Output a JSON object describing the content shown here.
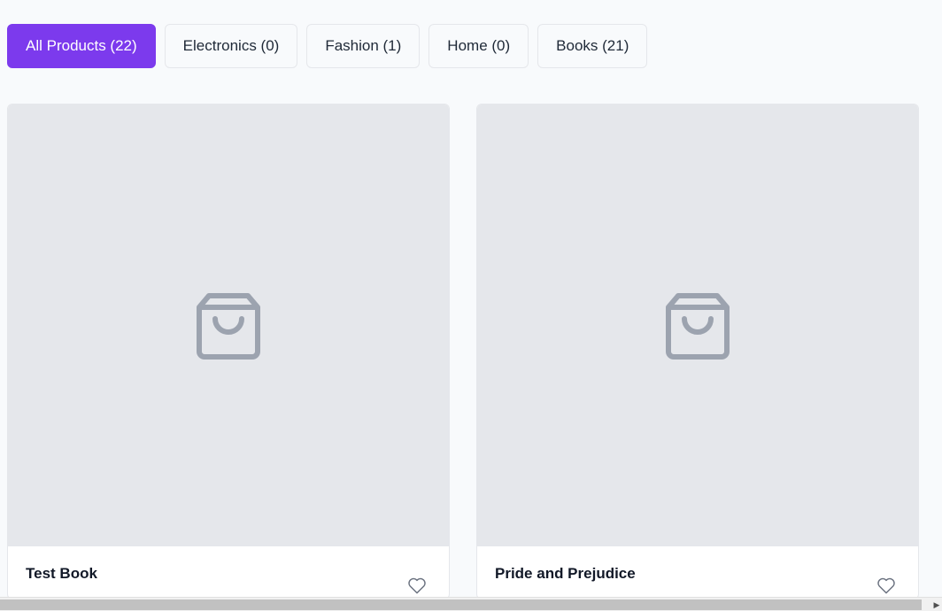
{
  "filters": [
    {
      "label": "All Products (22)",
      "active": true
    },
    {
      "label": "Electronics (0)",
      "active": false
    },
    {
      "label": "Fashion (1)",
      "active": false
    },
    {
      "label": "Home (0)",
      "active": false
    },
    {
      "label": "Books (21)",
      "active": false
    }
  ],
  "products": [
    {
      "title": "Test Book",
      "image_icon": "shopping-bag-icon",
      "favorite_icon": "heart-icon"
    },
    {
      "title": "Pride and Prejudice",
      "image_icon": "shopping-bag-icon",
      "favorite_icon": "heart-icon"
    }
  ],
  "scrollbar": {
    "arrow": "▶"
  },
  "colors": {
    "accent": "#7c3aed",
    "background": "#f8fafc",
    "placeholder": "#e5e7eb",
    "icon": "#9ca3af"
  }
}
